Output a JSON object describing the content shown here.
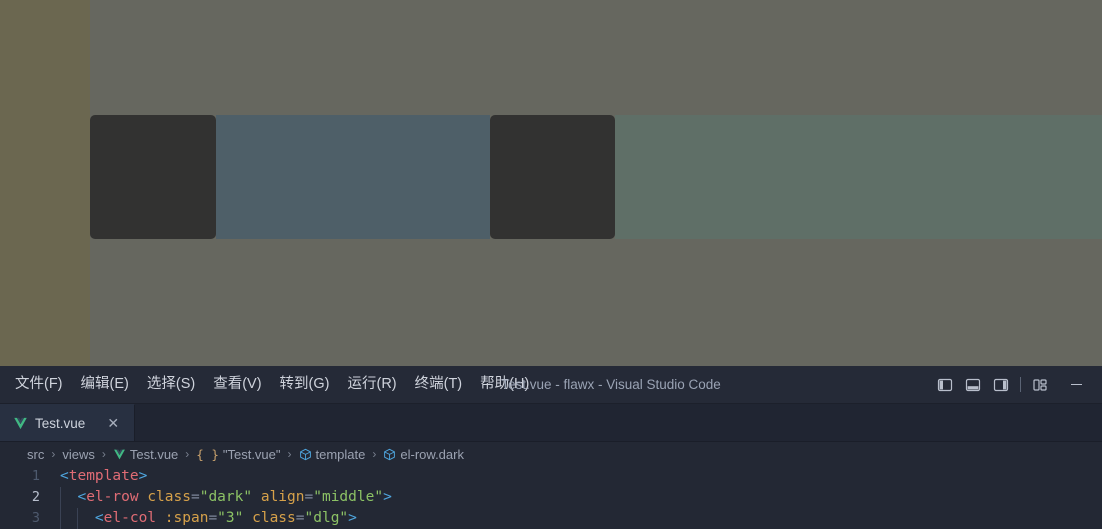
{
  "app_preview": {
    "name": "element-ui-el-row-preview",
    "background_color": "#66675f",
    "sidebar_color": "#6b6750",
    "row": {
      "class": "dark",
      "align": "middle",
      "columns": [
        {
          "name": "col-dark-1",
          "color": "#323231",
          "rounded": true
        },
        {
          "name": "col-blue",
          "color": "#4e5f68",
          "rounded": false
        },
        {
          "name": "col-dark-2",
          "color": "#323231",
          "rounded": true
        },
        {
          "name": "col-green",
          "color": "#5f6f67",
          "rounded": false
        }
      ]
    }
  },
  "vscode": {
    "window_title": "Test.vue - flawx - Visual Studio Code",
    "menus": [
      {
        "name": "menu-file",
        "label": "文件(F)"
      },
      {
        "name": "menu-edit",
        "label": "编辑(E)"
      },
      {
        "name": "menu-select",
        "label": "选择(S)"
      },
      {
        "name": "menu-view",
        "label": "查看(V)"
      },
      {
        "name": "menu-go",
        "label": "转到(G)"
      },
      {
        "name": "menu-run",
        "label": "运行(R)"
      },
      {
        "name": "menu-terminal",
        "label": "终端(T)"
      },
      {
        "name": "menu-help",
        "label": "帮助(H)"
      }
    ],
    "title_actions": [
      {
        "name": "toggle-primary-sidebar-icon",
        "tooltip": "切换主侧边栏"
      },
      {
        "name": "toggle-panel-icon",
        "tooltip": "切换面板"
      },
      {
        "name": "toggle-secondary-sidebar-icon",
        "tooltip": "切换辅助侧栏"
      },
      {
        "name": "customize-layout-icon",
        "tooltip": "自定义布局"
      },
      {
        "name": "minimize-window-button",
        "tooltip": "最小化"
      }
    ],
    "tabs": [
      {
        "name": "tab-test-vue",
        "label": "Test.vue",
        "icon": "vue-icon",
        "active": true,
        "close_glyph": "✕"
      }
    ],
    "breadcrumbs": [
      {
        "label": "src",
        "icon": ""
      },
      {
        "label": "views",
        "icon": ""
      },
      {
        "label": "Test.vue",
        "icon": "vue-icon"
      },
      {
        "label": "\"Test.vue\"",
        "icon": "braces-icon"
      },
      {
        "label": "template",
        "icon": "symbol-field-icon"
      },
      {
        "label": "el-row.dark",
        "icon": "symbol-field-icon"
      }
    ],
    "breadcrumb_separator": "›",
    "editor": {
      "lines": [
        {
          "number": "1",
          "active": false,
          "indent_guides": 0,
          "tokens": [
            {
              "t": "<",
              "c": "tok-bracket"
            },
            {
              "t": "template",
              "c": "tok-tag"
            },
            {
              "t": ">",
              "c": "tok-bracket"
            }
          ]
        },
        {
          "number": "2",
          "active": true,
          "indent_guides": 1,
          "tokens": [
            {
              "t": "  ",
              "c": "tok-punct"
            },
            {
              "t": "<",
              "c": "tok-bracket"
            },
            {
              "t": "el-row",
              "c": "tok-tag"
            },
            {
              "t": " ",
              "c": "tok-punct"
            },
            {
              "t": "class",
              "c": "tok-attr"
            },
            {
              "t": "=",
              "c": "tok-eq"
            },
            {
              "t": "\"dark\"",
              "c": "tok-string"
            },
            {
              "t": " ",
              "c": "tok-punct"
            },
            {
              "t": "align",
              "c": "tok-attr"
            },
            {
              "t": "=",
              "c": "tok-eq"
            },
            {
              "t": "\"middle\"",
              "c": "tok-string"
            },
            {
              "t": ">",
              "c": "tok-bracket"
            }
          ]
        },
        {
          "number": "3",
          "active": false,
          "indent_guides": 2,
          "tokens": [
            {
              "t": "    ",
              "c": "tok-punct"
            },
            {
              "t": "<",
              "c": "tok-bracket"
            },
            {
              "t": "el-col",
              "c": "tok-tag"
            },
            {
              "t": " ",
              "c": "tok-punct"
            },
            {
              "t": ":span",
              "c": "tok-attr"
            },
            {
              "t": "=",
              "c": "tok-eq"
            },
            {
              "t": "\"3\"",
              "c": "tok-string"
            },
            {
              "t": " ",
              "c": "tok-punct"
            },
            {
              "t": "class",
              "c": "tok-attr"
            },
            {
              "t": "=",
              "c": "tok-eq"
            },
            {
              "t": "\"dlg\"",
              "c": "tok-string"
            },
            {
              "t": ">",
              "c": "tok-bracket"
            }
          ]
        }
      ]
    }
  }
}
